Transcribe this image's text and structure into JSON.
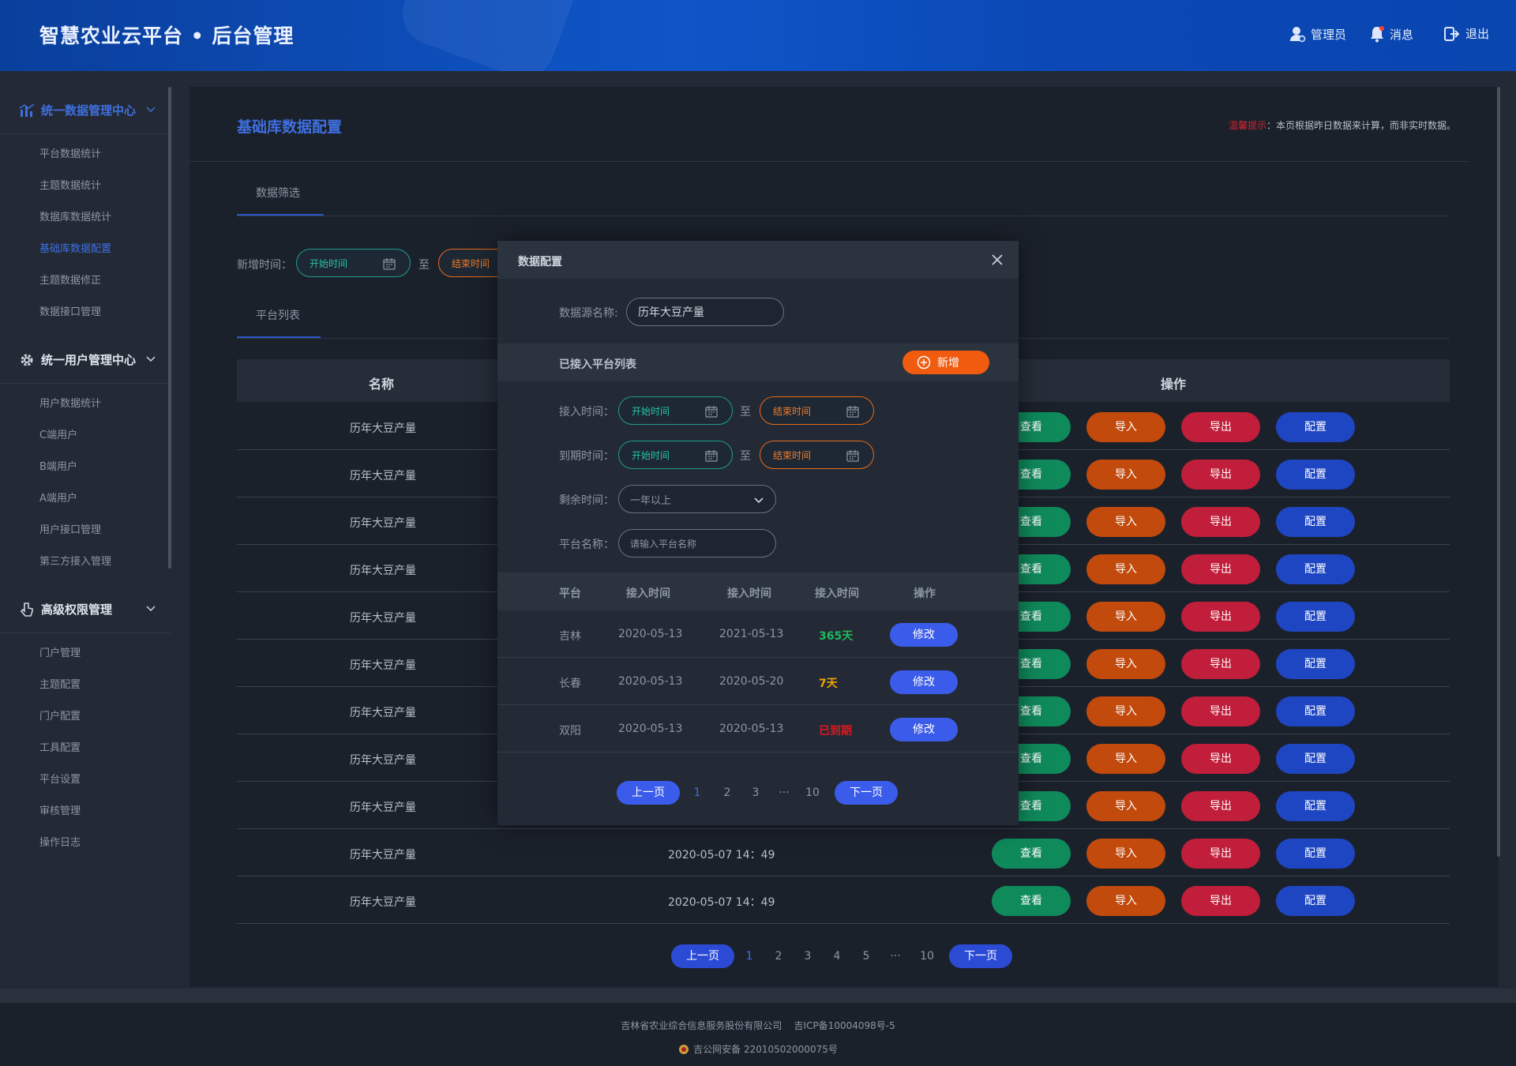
{
  "header": {
    "title": "智慧农业云平台 • 后台管理",
    "admin": "管理员",
    "messages": "消息",
    "logout": "退出"
  },
  "sidebar": {
    "groups": [
      {
        "label": "统一数据管理中心",
        "items": [
          "平台数据统计",
          "主题数据统计",
          "数据库数据统计",
          "基础库数据配置",
          "主题数据修正",
          "数据接口管理"
        ]
      },
      {
        "label": "统一用户管理中心",
        "items": [
          "用户数据统计",
          "C端用户",
          "B端用户",
          "A端用户",
          "用户接口管理",
          "第三方接入管理"
        ]
      },
      {
        "label": "高级权限管理",
        "items": [
          "门户管理",
          "主题配置",
          "门户配置",
          "工具配置",
          "平台设置",
          "审核管理",
          "操作日志"
        ]
      }
    ]
  },
  "page": {
    "title": "基础库数据配置",
    "tip_label": "温馨提示",
    "tip_text": "：本页根据昨日数据来计算，而非实时数据。",
    "filter_tab": "数据筛选",
    "filter_label": "新增时间：",
    "start_placeholder": "开始时间",
    "end_placeholder": "结束时间",
    "to": "至",
    "list_tab": "平台列表"
  },
  "table": {
    "col_name": "名称",
    "col_ops": "操作",
    "btn_view": "查看",
    "btn_import": "导入",
    "btn_export": "导出",
    "btn_config": "配置",
    "rows": [
      {
        "name": "历年大豆产量",
        "time": ""
      },
      {
        "name": "历年大豆产量",
        "time": ""
      },
      {
        "name": "历年大豆产量",
        "time": ""
      },
      {
        "name": "历年大豆产量",
        "time": ""
      },
      {
        "name": "历年大豆产量",
        "time": ""
      },
      {
        "name": "历年大豆产量",
        "time": ""
      },
      {
        "name": "历年大豆产量",
        "time": ""
      },
      {
        "name": "历年大豆产量",
        "time": ""
      },
      {
        "name": "历年大豆产量",
        "time": ""
      },
      {
        "name": "历年大豆产量",
        "time": "2020-05-07  14：49"
      },
      {
        "name": "历年大豆产量",
        "time": "2020-05-07  14：49"
      }
    ]
  },
  "pager": {
    "prev": "上一页",
    "next": "下一页",
    "pages": [
      "1",
      "2",
      "3",
      "4",
      "5",
      "···",
      "10"
    ]
  },
  "modal": {
    "title": "数据配置",
    "source_label": "数据源名称:",
    "source_value": "历年大豆产量",
    "list_title": "已接入平台列表",
    "add_btn": "新增",
    "access_label": "接入时间：",
    "expire_label": "到期时间：",
    "remain_label": "剩余时间：",
    "remain_value": "一年以上",
    "platform_label": "平台名称：",
    "platform_placeholder": "请输入平台名称",
    "start_placeholder": "开始时间",
    "end_placeholder": "结束时间",
    "to": "至",
    "columns": [
      "平台",
      "接入时间",
      "接入时间",
      "接入时间",
      "操作"
    ],
    "edit_btn": "修改",
    "rows": [
      {
        "platform": "吉林",
        "start": "2020-05-13",
        "end": "2021-05-13",
        "remain": "365天",
        "color": "#1fb85c"
      },
      {
        "platform": "长春",
        "start": "2020-05-13",
        "end": "2020-05-20",
        "remain": "7天",
        "color": "#f2a300"
      },
      {
        "platform": "双阳",
        "start": "2020-05-13",
        "end": "2020-05-13",
        "remain": "已到期",
        "color": "#e3161d"
      }
    ],
    "pager": {
      "prev": "上一页",
      "next": "下一页",
      "pages": [
        "1",
        "2",
        "3",
        "···",
        "10"
      ]
    }
  },
  "footer": {
    "company": "吉林省农业综合信息服务股份有限公司",
    "icp": "吉ICP备10004098号-5",
    "police": "吉公网安备 22010502000075号"
  },
  "colors": {
    "accent": "#3f6fe0",
    "view": "#0f8a5b",
    "import": "#c24a0d",
    "export": "#c01e3a",
    "config": "#1f46c2"
  }
}
